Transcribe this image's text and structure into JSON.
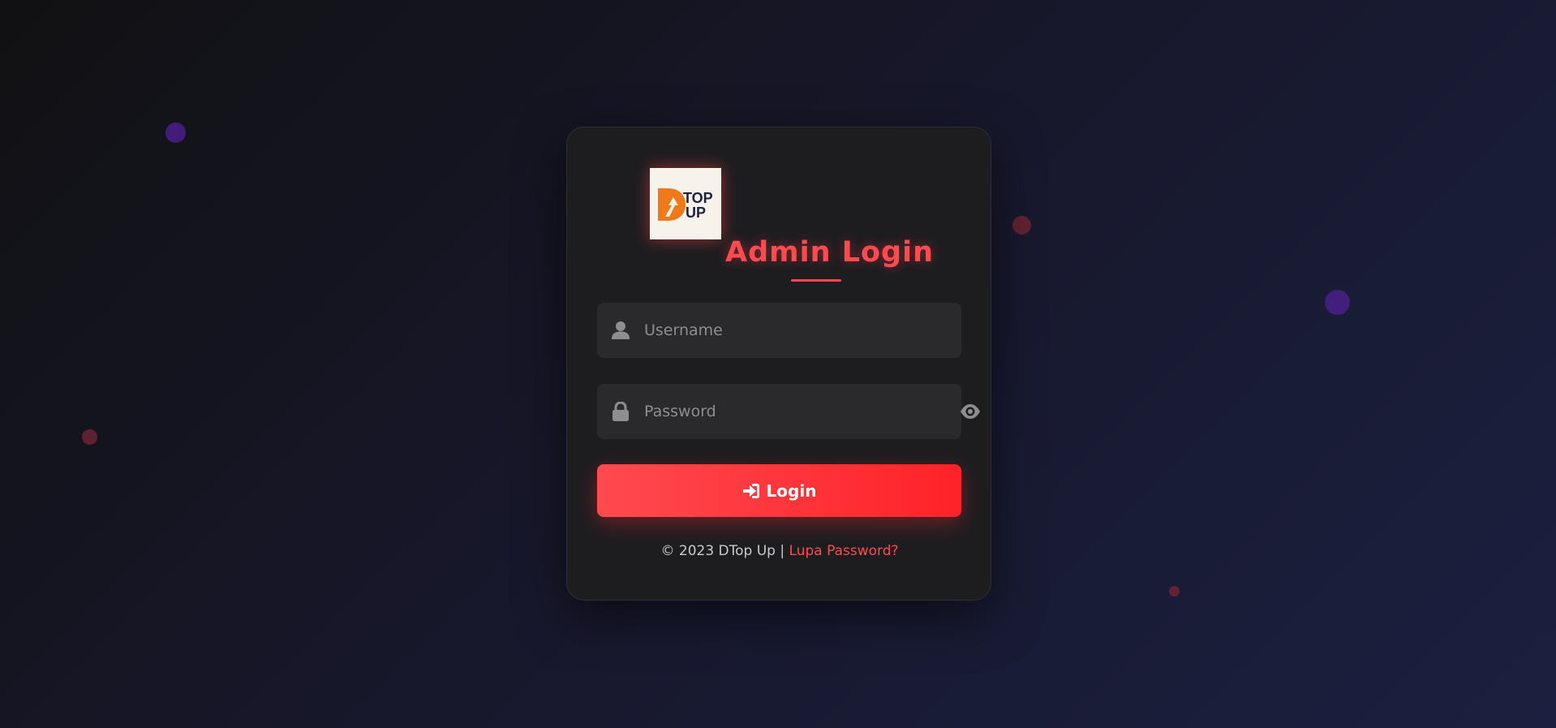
{
  "background": {
    "gradient_start": "#111113",
    "gradient_end": "#1b2040"
  },
  "logo": {
    "text_top": "TOP",
    "text_bottom": "UP",
    "letter": "D",
    "brand_orange": "#f07a1a",
    "brand_navy": "#1b2340"
  },
  "login_card": {
    "title": "Admin Login",
    "accent_color": "#ff4a4f",
    "username": {
      "icon": "user-icon",
      "placeholder": "Username",
      "value": ""
    },
    "password": {
      "icon": "lock-icon",
      "placeholder": "Password",
      "value": "",
      "toggle_icon": "eye-icon"
    },
    "login_button": {
      "icon": "sign-in-icon",
      "label": "Login"
    },
    "footer": {
      "copyright": "© 2023 DTop Up |",
      "forgot_link": "Lupa Password?"
    }
  }
}
